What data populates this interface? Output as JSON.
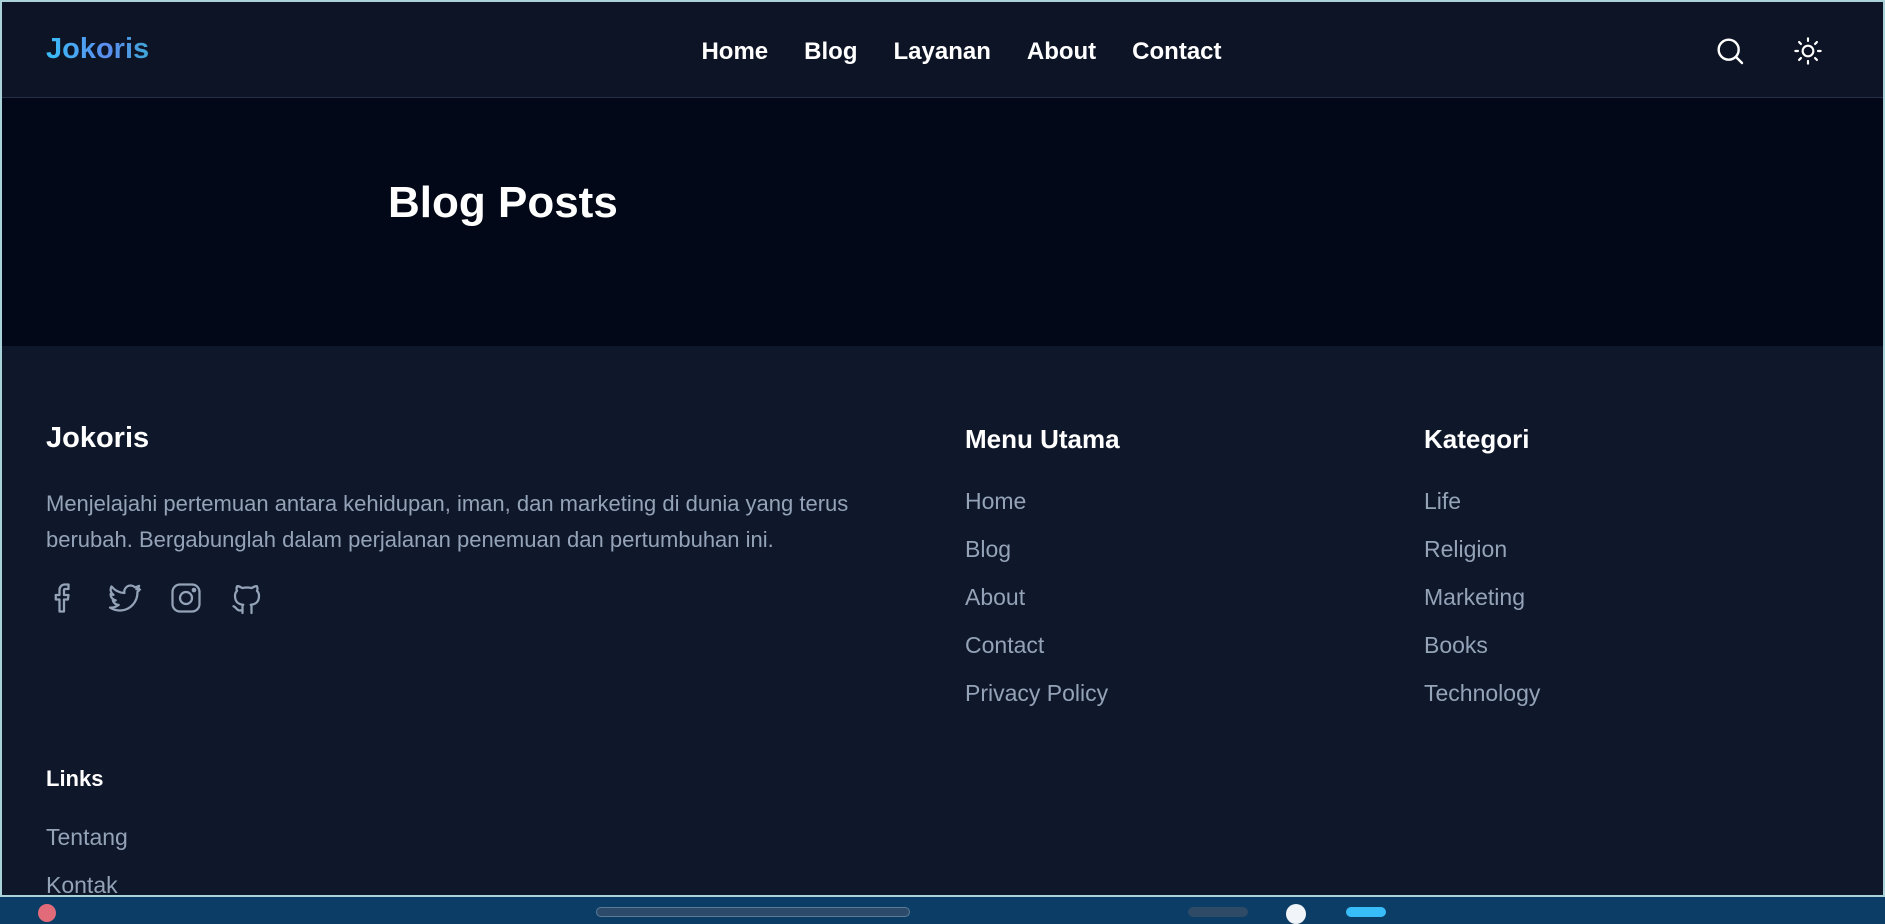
{
  "header": {
    "logo": "Jokoris",
    "nav": [
      "Home",
      "Blog",
      "Layanan",
      "About",
      "Contact"
    ],
    "icons": {
      "search": "search-icon",
      "theme": "sun-icon"
    }
  },
  "hero": {
    "title": "Blog Posts"
  },
  "footer": {
    "brand": "Jokoris",
    "description": "Menjelajahi pertemuan antara kehidupan, iman, dan marketing di dunia yang terus berubah. Bergabunglah dalam perjalanan penemuan dan pertumbuhan ini.",
    "socials": [
      "facebook-icon",
      "twitter-icon",
      "instagram-icon",
      "github-icon"
    ],
    "menu_utama": {
      "title": "Menu Utama",
      "items": [
        "Home",
        "Blog",
        "About",
        "Contact",
        "Privacy Policy"
      ]
    },
    "kategori": {
      "title": "Kategori",
      "items": [
        "Life",
        "Religion",
        "Marketing",
        "Books",
        "Technology"
      ]
    },
    "links": {
      "title": "Links",
      "items": [
        "Tentang",
        "Kontak"
      ]
    }
  },
  "colors": {
    "header_bg": "#0d1426",
    "hero_bg": "#020817",
    "footer_bg": "#0f172a",
    "muted_text": "#94a3b8",
    "logo_gradient": [
      "#38bdf8",
      "#5b8def"
    ]
  }
}
